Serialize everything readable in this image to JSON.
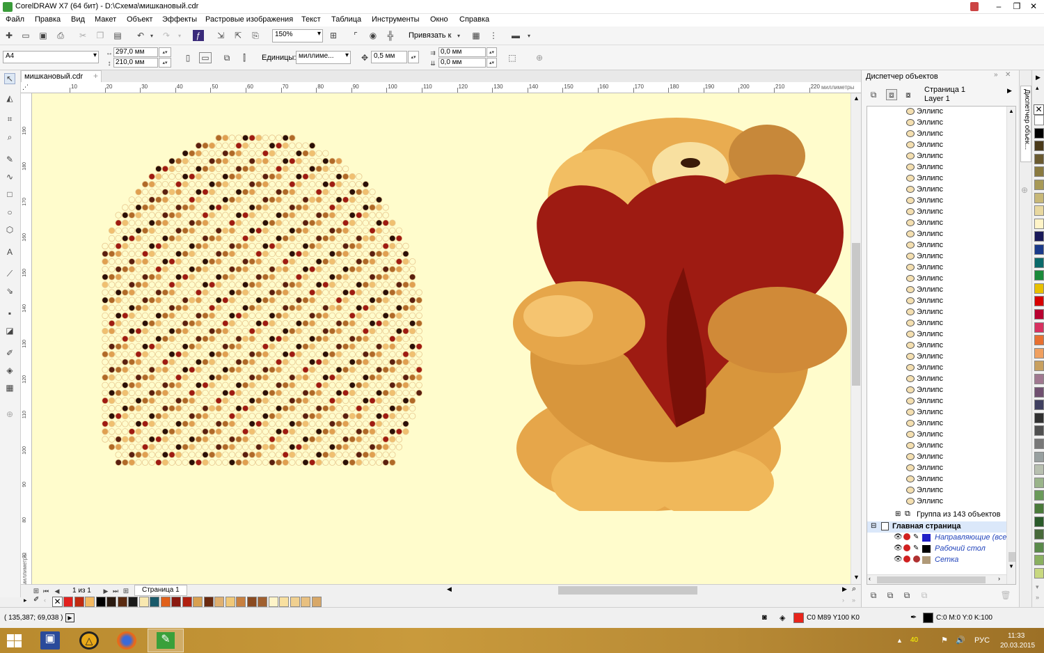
{
  "window": {
    "title": "CorelDRAW X7 (64 бит) - D:\\Схема\\мишкановый.cdr",
    "min_icon": "minimize-icon",
    "max_icon": "maximize-icon",
    "close_icon": "close-icon"
  },
  "menu": [
    "Файл",
    "Правка",
    "Вид",
    "Макет",
    "Объект",
    "Эффекты",
    "Растровые изображения",
    "Текст",
    "Таблица",
    "Инструменты",
    "Окно",
    "Справка"
  ],
  "toolbar": {
    "zoom": "150%",
    "snap_label": "Привязать к"
  },
  "propbar": {
    "page_size": "A4",
    "width": "297,0 мм",
    "height": "210,0 мм",
    "units_label": "Единицы:",
    "units_value": "миллиме...",
    "nudge": "0,5 мм",
    "dup_x": "0,0 мм",
    "dup_y": "0,0 мм"
  },
  "document": {
    "tab": "мишкановый.cdr",
    "page_counter": "1 из 1",
    "page_tab": "Страница 1"
  },
  "ruler": {
    "h_ticks": [
      "10",
      "20",
      "30",
      "40",
      "50",
      "60",
      "70",
      "80",
      "90",
      "100",
      "110",
      "120",
      "130",
      "140",
      "150",
      "160",
      "170",
      "180",
      "190",
      "200",
      "210",
      "220"
    ],
    "h_unit": "миллиметры",
    "v_unit": "миллиметры",
    "v_ticks": [
      "190",
      "180",
      "170",
      "160",
      "150",
      "140",
      "130",
      "120",
      "110",
      "100",
      "90",
      "80",
      "70"
    ]
  },
  "docker": {
    "title": "Диспетчер объектов",
    "page": "Страница 1",
    "layer": "Layer 1",
    "items_label": "Эллипс",
    "items_count": 36,
    "group": "Группа из 143 объектов",
    "master": "Главная страница",
    "master_layers": [
      "Направляющие (все",
      "Рабочий стол",
      "Сетка"
    ],
    "side_tab": "Диспетчер объек..."
  },
  "status": {
    "coords": "( 135,387; 69,038 )",
    "fill": "C0 M89 Y100 K0",
    "outline": "C:0 M:0 Y:0 K:100"
  },
  "taskbar": {
    "time": "11:33",
    "date": "20.03.2015",
    "lang": "РУС",
    "notif": "40"
  },
  "colors": {
    "fill": "#e8251c",
    "outline": "#000000",
    "canvas": "#fffccc"
  },
  "palette": [
    "#ffffff",
    "#000000",
    "#4a3a1a",
    "#6a5a30",
    "#8a7a40",
    "#a89a58",
    "#c8b878",
    "#e8d8a0",
    "#fff4c8",
    "#1a1a5a",
    "#1a3a8a",
    "#0a6a6a",
    "#1a8a3a",
    "#e8c000",
    "#d80000",
    "#b80030",
    "#d83060",
    "#e87030",
    "#f0a060",
    "#c8a060",
    "#a07890",
    "#705070",
    "#404060",
    "#303030",
    "#505050",
    "#787878",
    "#98a0a0",
    "#b8c0b0",
    "#9ab48a",
    "#6a9a5a",
    "#4a7a3a",
    "#2a5a2a",
    "#486a3a",
    "#5a8a4a",
    "#8ab060",
    "#c8d880"
  ],
  "doc_palette": [
    "#e2201e",
    "#c02a10",
    "#f2b860",
    "#000000",
    "#2a1a10",
    "#5a2a10",
    "#1a1a1a",
    "#f8e8b0",
    "#1a5a6a",
    "#e0601a",
    "#8a1a10",
    "#b02010",
    "#d8a050",
    "#6a2a10",
    "#e0b070",
    "#f0c878",
    "#c88040",
    "#8a4a20",
    "#a06030",
    "#fff4c8",
    "#f8e0a0",
    "#f0d090",
    "#e8c080",
    "#d8a868"
  ]
}
